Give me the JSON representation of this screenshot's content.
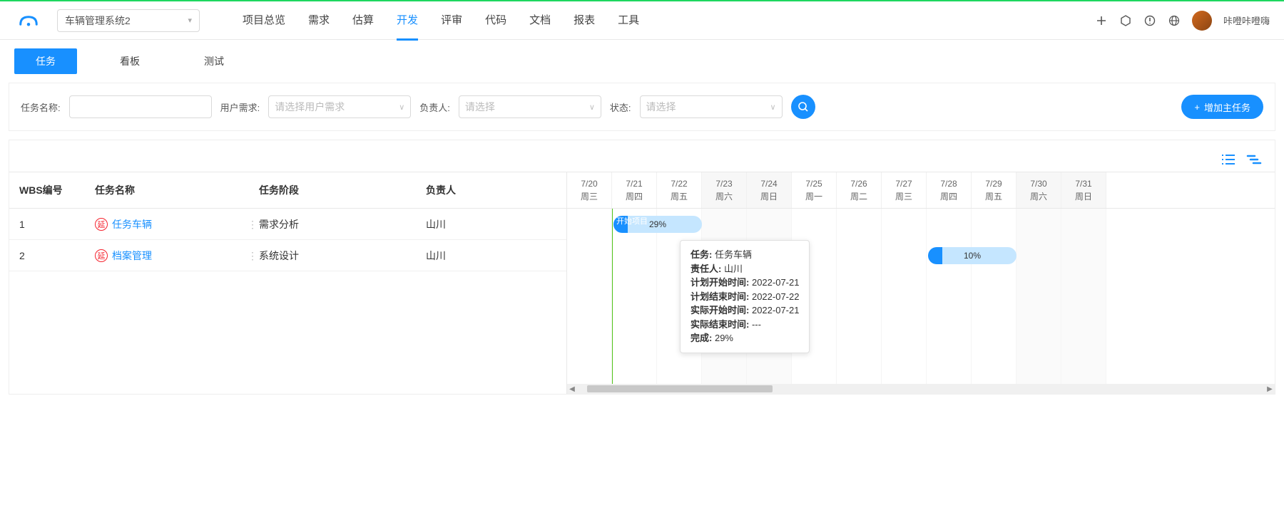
{
  "project_select": {
    "value": "车辆管理系统2"
  },
  "main_nav": [
    "项目总览",
    "需求",
    "估算",
    "开发",
    "评审",
    "代码",
    "文档",
    "报表",
    "工具"
  ],
  "main_nav_active": 3,
  "user": {
    "name": "咔噔咔噔嗨"
  },
  "sub_tabs": [
    "任务",
    "看板",
    "测试"
  ],
  "sub_tab_active": 0,
  "filters": {
    "task_name_label": "任务名称:",
    "user_req_label": "用户需求:",
    "user_req_placeholder": "请选择用户需求",
    "owner_label": "负责人:",
    "owner_placeholder": "请选择",
    "status_label": "状态:",
    "status_placeholder": "请选择",
    "add_button": "增加主任务"
  },
  "table": {
    "headers": {
      "wbs": "WBS编号",
      "name": "任务名称",
      "phase": "任务阶段",
      "owner": "负责人"
    },
    "rows": [
      {
        "wbs": "1",
        "badge": "延",
        "name": "任务车辆",
        "phase": "需求分析",
        "owner": "山川"
      },
      {
        "wbs": "2",
        "badge": "延",
        "name": "档案管理",
        "phase": "系统设计",
        "owner": "山川"
      }
    ]
  },
  "gantt": {
    "columns": [
      {
        "date": "7/20",
        "dow": "周三",
        "weekend": false
      },
      {
        "date": "7/21",
        "dow": "周四",
        "weekend": false
      },
      {
        "date": "7/22",
        "dow": "周五",
        "weekend": false
      },
      {
        "date": "7/23",
        "dow": "周六",
        "weekend": true
      },
      {
        "date": "7/24",
        "dow": "周日",
        "weekend": true
      },
      {
        "date": "7/25",
        "dow": "周一",
        "weekend": false
      },
      {
        "date": "7/26",
        "dow": "周二",
        "weekend": false
      },
      {
        "date": "7/27",
        "dow": "周三",
        "weekend": false
      },
      {
        "date": "7/28",
        "dow": "周四",
        "weekend": false
      },
      {
        "date": "7/29",
        "dow": "周五",
        "weekend": false
      },
      {
        "date": "7/30",
        "dow": "周六",
        "weekend": true
      },
      {
        "date": "7/31",
        "dow": "周日",
        "weekend": true
      }
    ],
    "bars": [
      {
        "row": 0,
        "label": "开始项目",
        "pct": "29%"
      },
      {
        "row": 1,
        "label": "",
        "pct": "10%"
      }
    ]
  },
  "tooltip": {
    "task_k": "任务:",
    "task_v": "任务车辆",
    "owner_k": "责任人:",
    "owner_v": "山川",
    "ps_k": "计划开始时间:",
    "ps_v": "2022-07-21",
    "pe_k": "计划结束时间:",
    "pe_v": "2022-07-22",
    "as_k": "实际开始时间:",
    "as_v": "2022-07-21",
    "ae_k": "实际结束时间:",
    "ae_v": "---",
    "done_k": "完成:",
    "done_v": "29%"
  }
}
